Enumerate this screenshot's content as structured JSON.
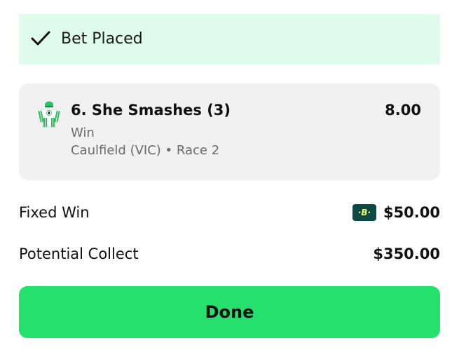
{
  "banner": {
    "icon": "check-icon",
    "text": "Bet Placed",
    "background": "#dffbe9"
  },
  "bet_card": {
    "silks_icon": "jockey-silks-icon",
    "runner": "6. She Smashes (3)",
    "odds": "8.00",
    "bet_type": "Win",
    "race": "Caulfield (VIC) • Race 2"
  },
  "fixed_win": {
    "label": "Fixed Win",
    "badge": "·B·",
    "amount": "$50.00"
  },
  "potential_collect": {
    "label": "Potential Collect",
    "amount": "$350.00"
  },
  "done_button": {
    "label": "Done",
    "color": "#25e06d"
  }
}
